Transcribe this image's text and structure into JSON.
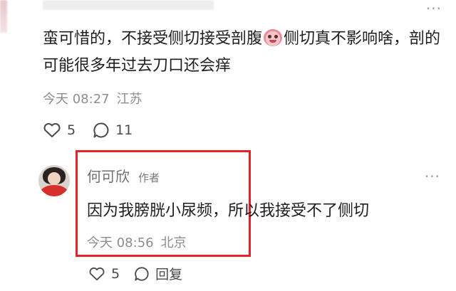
{
  "comment1": {
    "text": "蛮可惜的，不接受侧切接受剖腹",
    "text_after_emoji": "侧切真不影响啥，剖的可能很多年过去刀口还会痒",
    "time": "今天 08:27",
    "location": "江苏",
    "likes": "5",
    "comments": "11"
  },
  "reply": {
    "author": "何可欣",
    "author_tag": "作者",
    "text": "因为我膀胱小尿频，所以我接受不了侧切",
    "time": "今天 08:56",
    "location": "北京",
    "likes": "5",
    "reply_label": "回复"
  },
  "colors": {
    "highlight_border": "#e0242b",
    "meta_text": "#8d8d8d"
  },
  "icons": {
    "more": "more-dots-icon",
    "like": "heart-icon",
    "comment": "comment-bubble-icon",
    "emoji": "pig-face-emoji"
  }
}
